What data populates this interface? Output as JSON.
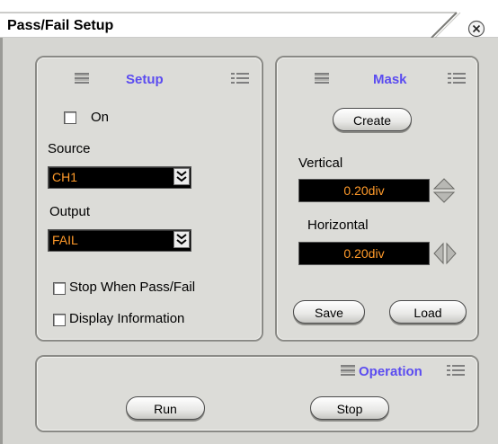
{
  "window": {
    "title": "Pass/Fail Setup"
  },
  "setup": {
    "title": "Setup",
    "on_label": "On",
    "on_checked": false,
    "source_label": "Source",
    "source_value": "CH1",
    "output_label": "Output",
    "output_value": "FAIL",
    "stop_when_label": "Stop When Pass/Fail",
    "stop_when_checked": false,
    "display_info_label": "Display Information",
    "display_info_checked": false
  },
  "mask": {
    "title": "Mask",
    "create_label": "Create",
    "vertical_label": "Vertical",
    "vertical_value": "0.20div",
    "horizontal_label": "Horizontal",
    "horizontal_value": "0.20div",
    "save_label": "Save",
    "load_label": "Load"
  },
  "operation": {
    "title": "Operation",
    "run_label": "Run",
    "stop_label": "Stop"
  },
  "colors": {
    "accent": "#5b4cf0",
    "value": "#ff9a2a",
    "panel": "#dcdcd8"
  },
  "icons": [
    "close-icon",
    "grip-icon",
    "dropdown-chevron-icon",
    "up-down-arrow-icon",
    "left-right-arrow-icon"
  ]
}
